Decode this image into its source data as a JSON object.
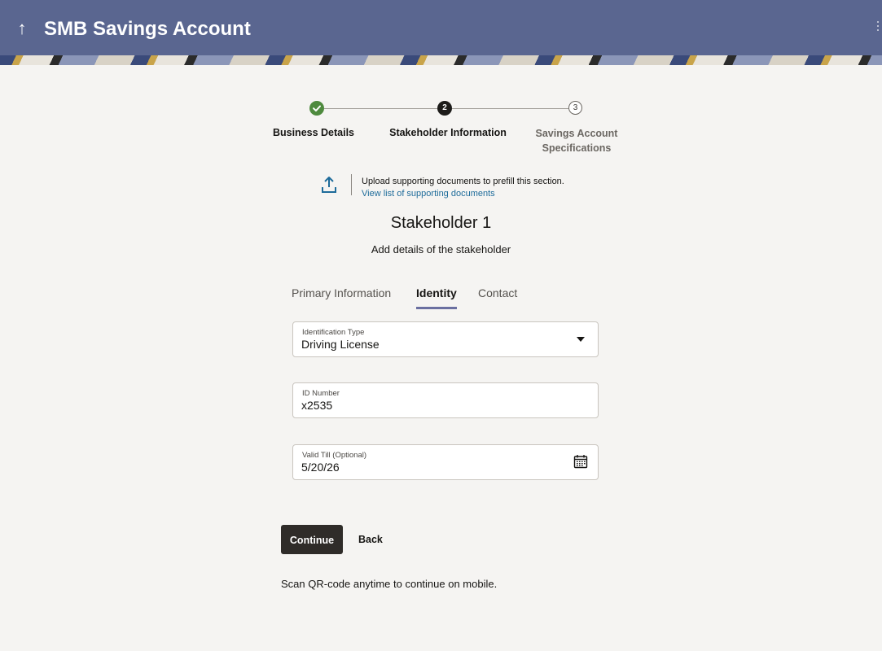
{
  "header": {
    "title": "SMB Savings Account",
    "back_icon": "up-arrow-icon",
    "menu_icon": "kebab-menu-icon",
    "color": "#5a6690"
  },
  "stepper": {
    "steps": [
      {
        "label": "Business Details",
        "status": "complete",
        "marker": ""
      },
      {
        "label": "Stakeholder Information",
        "status": "active",
        "marker": "2"
      },
      {
        "label": "Savings Account Specifications",
        "status": "pending",
        "marker": "3"
      }
    ],
    "complete_color": "#4e8a3e"
  },
  "upload": {
    "icon": "upload-icon",
    "text": "Upload supporting documents to prefill this section.",
    "link": "View list of supporting documents"
  },
  "section": {
    "title": "Stakeholder 1",
    "subtitle": "Add details of the stakeholder"
  },
  "tabs": [
    {
      "label": "Primary Information",
      "active": false
    },
    {
      "label": "Identity",
      "active": true
    },
    {
      "label": "Contact",
      "active": false
    }
  ],
  "fields": {
    "identification_type": {
      "label": "Identification Type",
      "value": "Driving License"
    },
    "id_number": {
      "label": "ID Number",
      "value": "x2535"
    },
    "valid_till": {
      "label": "Valid Till (Optional)",
      "value": "5/20/26"
    }
  },
  "actions": {
    "continue_label": "Continue",
    "back_label": "Back"
  },
  "footer": {
    "qr_note": "Scan QR-code anytime to continue on mobile."
  }
}
